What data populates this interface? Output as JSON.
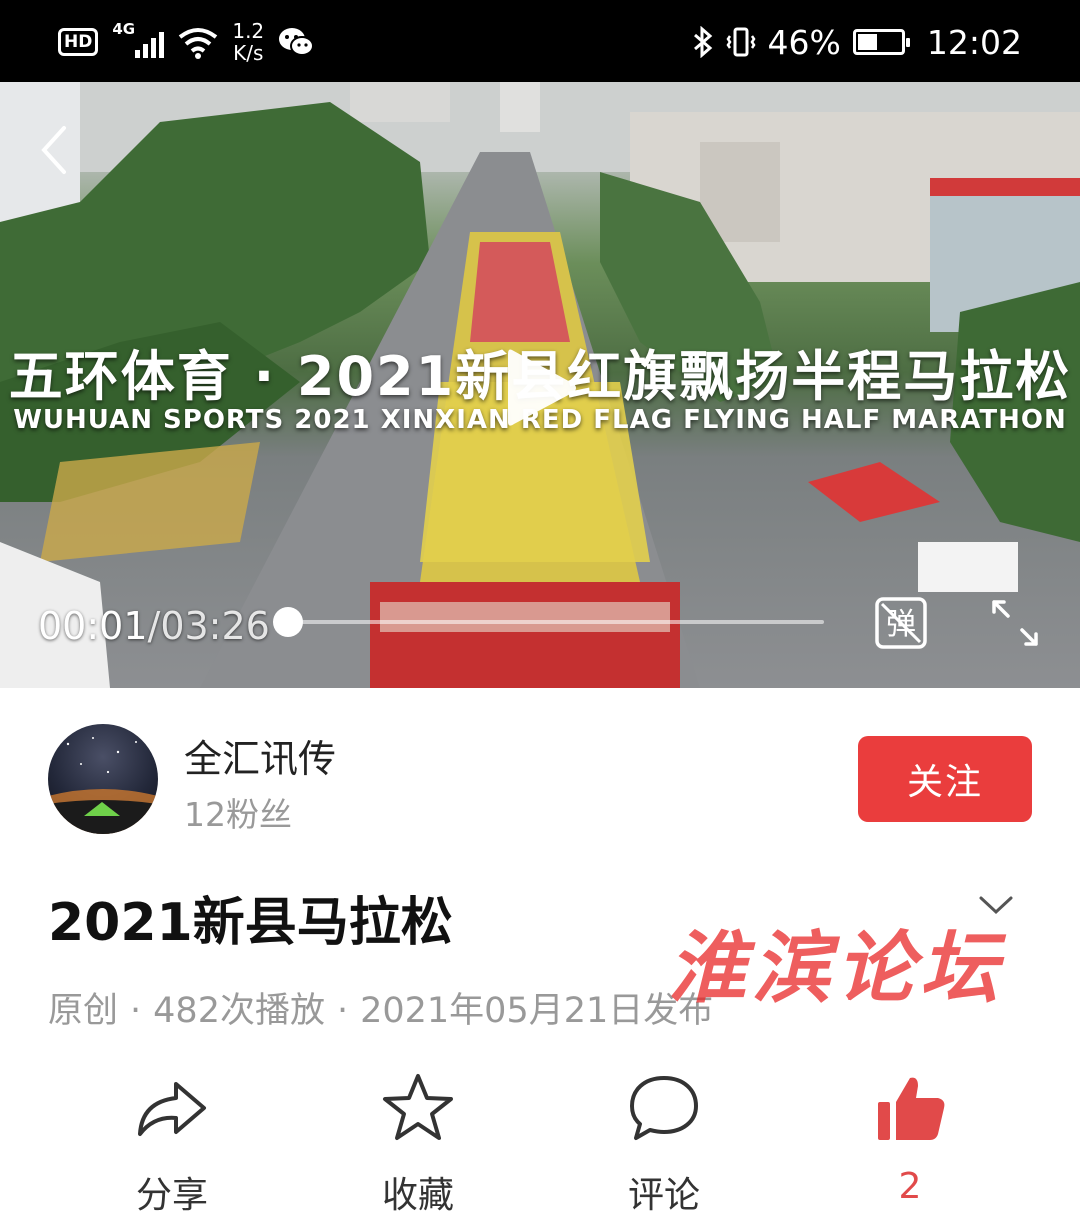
{
  "status_bar": {
    "hd": "HD",
    "network": "4G",
    "speed_value": "1.2",
    "speed_unit": "K/s",
    "battery": "46%",
    "battery_level": 0.46,
    "time": "12:02"
  },
  "video": {
    "overlay_title_cn": "五环体育 · 2021新县红旗飘扬半程马拉松",
    "overlay_title_en": "WUHUAN SPORTS 2021 XINXIAN RED FLAG FLYING HALF MARATHON",
    "current_time": "00:01",
    "total_time": "/03:26",
    "progress": 0.005
  },
  "author": {
    "name": "全汇讯传",
    "fans": "12粉丝",
    "follow_label": "关注"
  },
  "post": {
    "title": "2021新县马拉松",
    "type": "原创",
    "plays": "482次播放",
    "date": "2021年05月21日发布",
    "separator": "·"
  },
  "watermark": "淮滨论坛",
  "actions": {
    "share": "分享",
    "favorite": "收藏",
    "comment": "评论",
    "like_count": "2"
  },
  "colors": {
    "accent": "#ea3d3d",
    "like": "#e14a4a",
    "muted_text": "#999999"
  },
  "icons": [
    "back-icon",
    "play-icon",
    "danmaku-icon",
    "fullscreen-icon",
    "chevron-down-icon",
    "share-icon",
    "star-icon",
    "comment-icon",
    "thumbs-up-icon",
    "bluetooth-icon",
    "vibrate-icon",
    "wifi-icon",
    "wechat-icon",
    "battery-icon"
  ]
}
